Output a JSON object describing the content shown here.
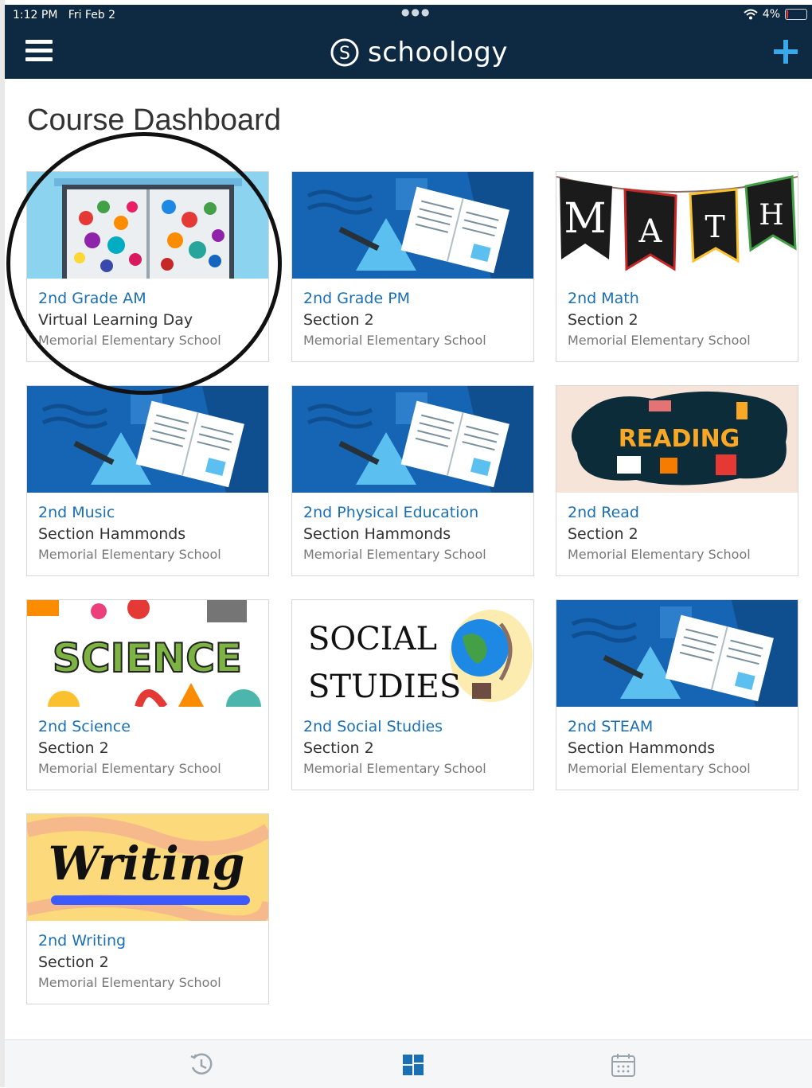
{
  "status_bar": {
    "time": "1:12 PM",
    "date": "Fri Feb 2",
    "battery": "4%"
  },
  "header": {
    "logo_text": "schoology",
    "menu_icon": "hamburger-menu-icon",
    "add_icon": "plus-icon"
  },
  "colors": {
    "header_bg": "#0e2a43",
    "accent": "#3aa7e8",
    "course_link": "#1b6fb3"
  },
  "page_title": "Course Dashboard",
  "courses": [
    {
      "name": "2nd Grade AM",
      "section": "Virtual Learning Day",
      "school": "Memorial Elementary School",
      "image": "open-book-apps-image"
    },
    {
      "name": "2nd Grade PM",
      "section": "Section 2",
      "school": "Memorial Elementary School",
      "image": "default-course-book-image"
    },
    {
      "name": "2nd Math",
      "section": "Section 2",
      "school": "Memorial Elementary School",
      "image": "math-banner-image",
      "image_text": [
        "M",
        "A",
        "T",
        "H"
      ]
    },
    {
      "name": "2nd Music",
      "section": "Section Hammonds",
      "school": "Memorial Elementary School",
      "image": "default-course-book-image"
    },
    {
      "name": "2nd Physical Education",
      "section": "Section Hammonds",
      "school": "Memorial Elementary School",
      "image": "default-course-book-image"
    },
    {
      "name": "2nd Read",
      "section": "Section 2",
      "school": "Memorial Elementary School",
      "image": "reading-image",
      "image_text": "READING"
    },
    {
      "name": "2nd Science",
      "section": "Section 2",
      "school": "Memorial Elementary School",
      "image": "science-image",
      "image_text": "SCIENCE"
    },
    {
      "name": "2nd Social Studies",
      "section": "Section 2",
      "school": "Memorial Elementary School",
      "image": "social-studies-globe-image",
      "image_text": [
        "SOCIAL",
        "STUDIES"
      ]
    },
    {
      "name": "2nd STEAM",
      "section": "Section Hammonds",
      "school": "Memorial Elementary School",
      "image": "default-course-book-image"
    },
    {
      "name": "2nd Writing",
      "section": "Section 2",
      "school": "Memorial Elementary School",
      "image": "writing-image",
      "image_text": "Writing"
    }
  ],
  "bottom_nav": {
    "items": [
      "recent-activity-icon",
      "courses-grid-icon",
      "calendar-icon"
    ],
    "active": "courses-grid-icon"
  }
}
